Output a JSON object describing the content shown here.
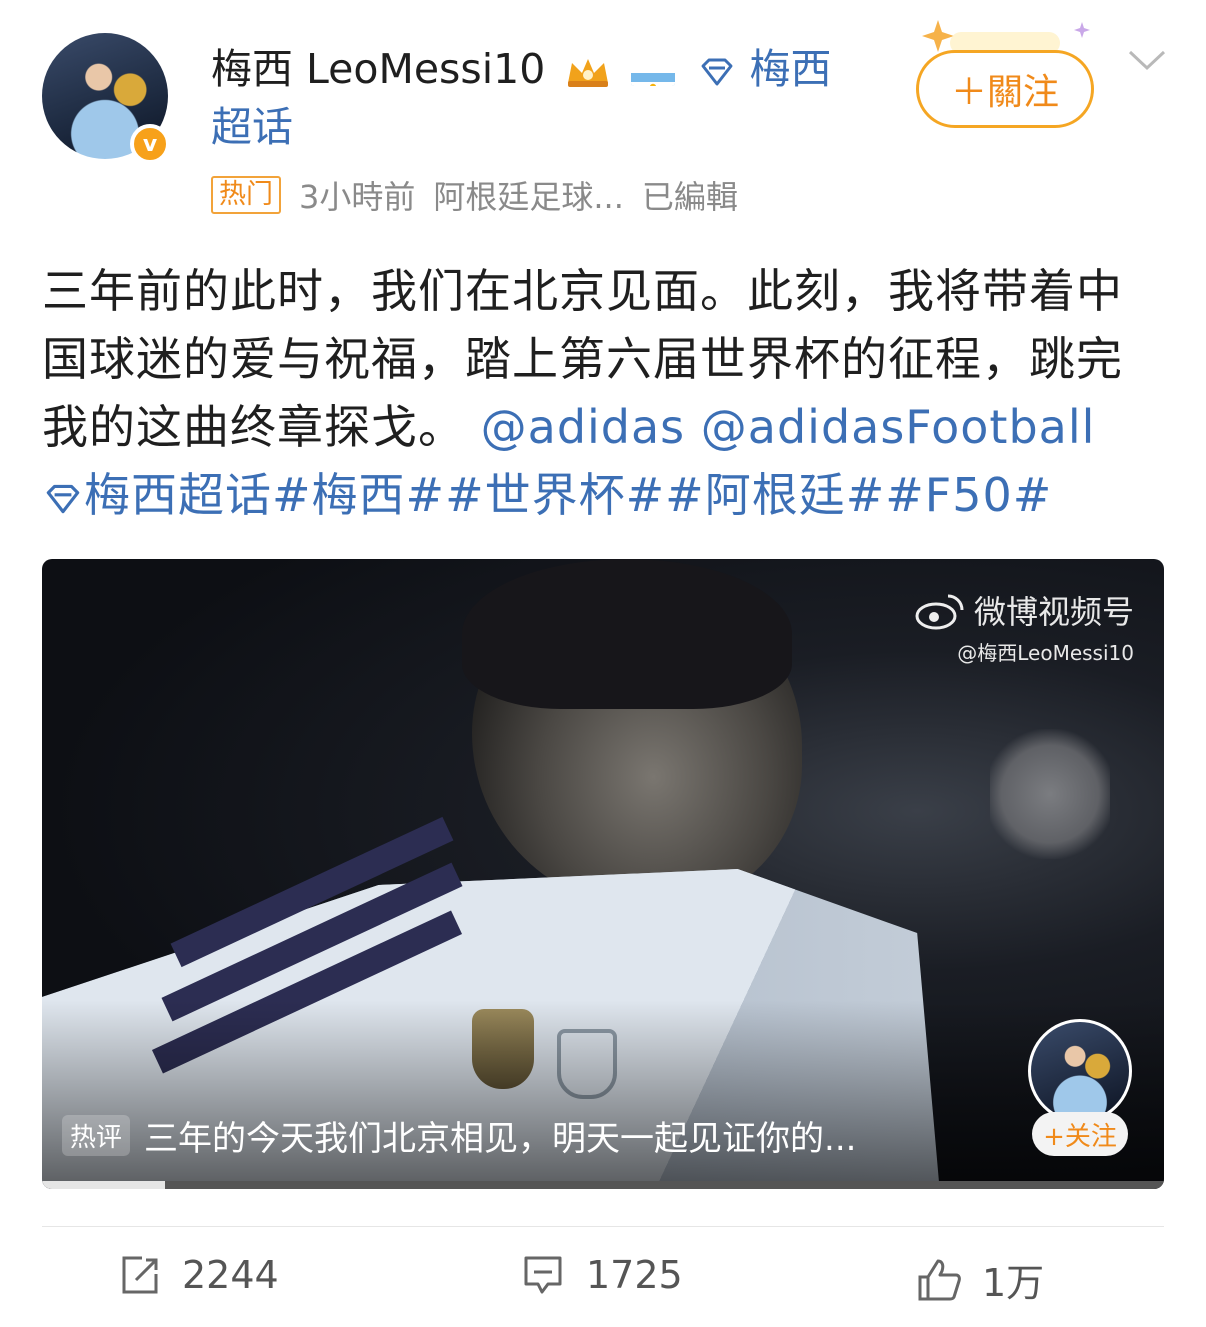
{
  "author": {
    "name": "梅西 LeoMessi10",
    "topic_link": "梅西",
    "topic_link_line2": "超话",
    "verified_icon": "v"
  },
  "meta": {
    "hot_badge": "热门",
    "time": "3小時前",
    "source": "阿根廷足球...",
    "edited": "已編輯"
  },
  "follow_button": "＋關注",
  "post": {
    "text": "三年前的此时，我们在北京见面。此刻，我将带着中国球迷的爱与祝福，踏上第六届世界杯的征程，跳完我的这曲终章探戈。",
    "mentions": [
      "@adidas",
      "@adidasFootball"
    ],
    "topic": "梅西超话",
    "hashtags": "#梅西##世界杯##阿根廷##F50#"
  },
  "video": {
    "watermark_title": "微博视频号",
    "watermark_user": "@梅西LeoMessi10",
    "follow_label": "+关注",
    "comment_tag": "热评",
    "comment_text": "三年的今天我们北京相见，明天一起见证你的...",
    "progress": 0.11
  },
  "actions": {
    "repost_count": "2244",
    "comment_count": "1725",
    "like_count": "1万"
  },
  "colors": {
    "accent_orange": "#f08a1a",
    "link_blue": "#3c6fb5",
    "text_gray": "#8a8a8a"
  }
}
